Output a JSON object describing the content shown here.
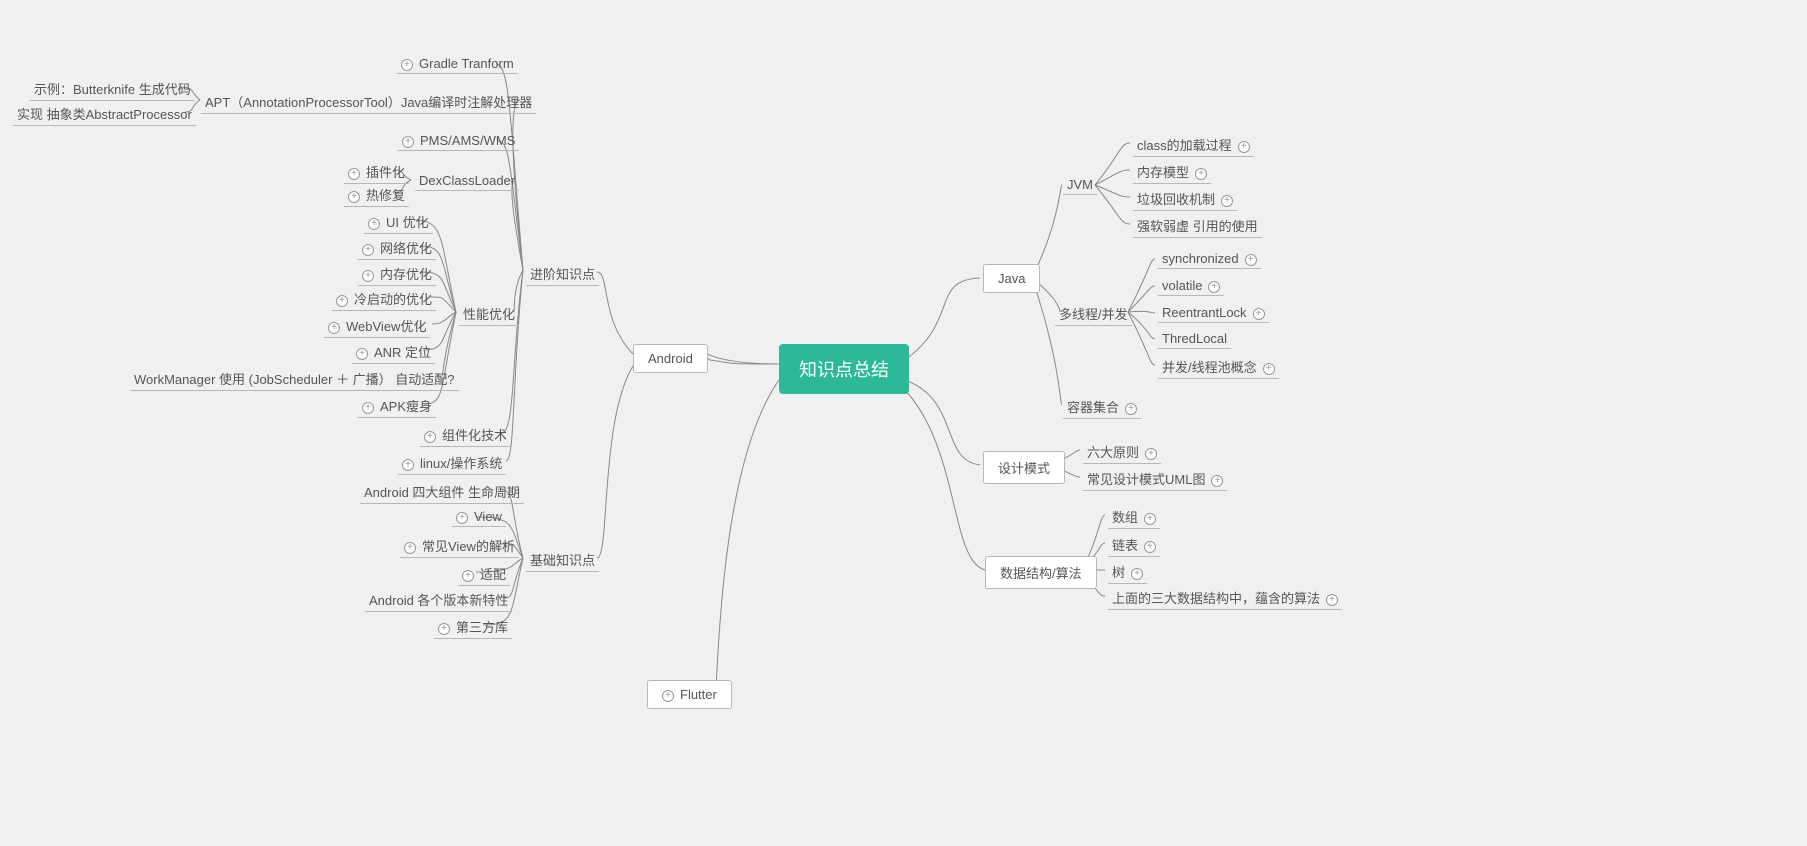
{
  "root": "知识点总结",
  "left": {
    "android": "Android",
    "flutter": "Flutter",
    "adv": "进阶知识点",
    "basic": "基础知识点",
    "gradle": "Gradle Tranform",
    "apt": "APT（AnnotationProcessorTool）Java编译时注解处理器",
    "apt_c1": "示例：Butterknife 生成代码",
    "apt_c2": "实现 抽象类AbstractProcessor",
    "pms": "PMS/AMS/WMS",
    "dex": "DexClassLoader",
    "dex_c1": "插件化",
    "dex_c2": "热修复",
    "perf": "性能优化",
    "perf_ui": "UI 优化",
    "perf_net": "网络优化",
    "perf_mem": "内存优化",
    "perf_cold": "冷启动的优化",
    "perf_wv": "WebView优化",
    "perf_anr": "ANR 定位",
    "perf_wm": "WorkManager 使用 (JobScheduler ＋ 广播） 自动适配?",
    "perf_apk": "APK瘦身",
    "comp": "组件化技术",
    "linux": "linux/操作系统",
    "b_life": "Android 四大组件 生命周期",
    "b_view": "View",
    "b_cview": "常见View的解析",
    "b_adapt": "适配",
    "b_ver": "Android  各个版本新特性",
    "b_thirdparty": "第三方库"
  },
  "right": {
    "java": "Java",
    "design": "设计模式",
    "ds": "数据结构/算法",
    "jvm": "JVM",
    "jvm_c1": "class的加载过程",
    "jvm_c2": "内存模型",
    "jvm_c3": "垃圾回收机制",
    "jvm_c4": "强软弱虚 引用的使用",
    "mt": "多线程/并发",
    "mt_c1": "synchronized",
    "mt_c2": "volatile",
    "mt_c3": "ReentrantLock",
    "mt_c4": "ThredLocal",
    "mt_c5": "并发/线程池概念",
    "container": "容器集合",
    "d_c1": "六大原则",
    "d_c2": "常见设计模式UML图",
    "ds_c1": "数组",
    "ds_c2": "链表",
    "ds_c3": "树",
    "ds_c4": "上面的三大数据结构中，蕴含的算法"
  }
}
